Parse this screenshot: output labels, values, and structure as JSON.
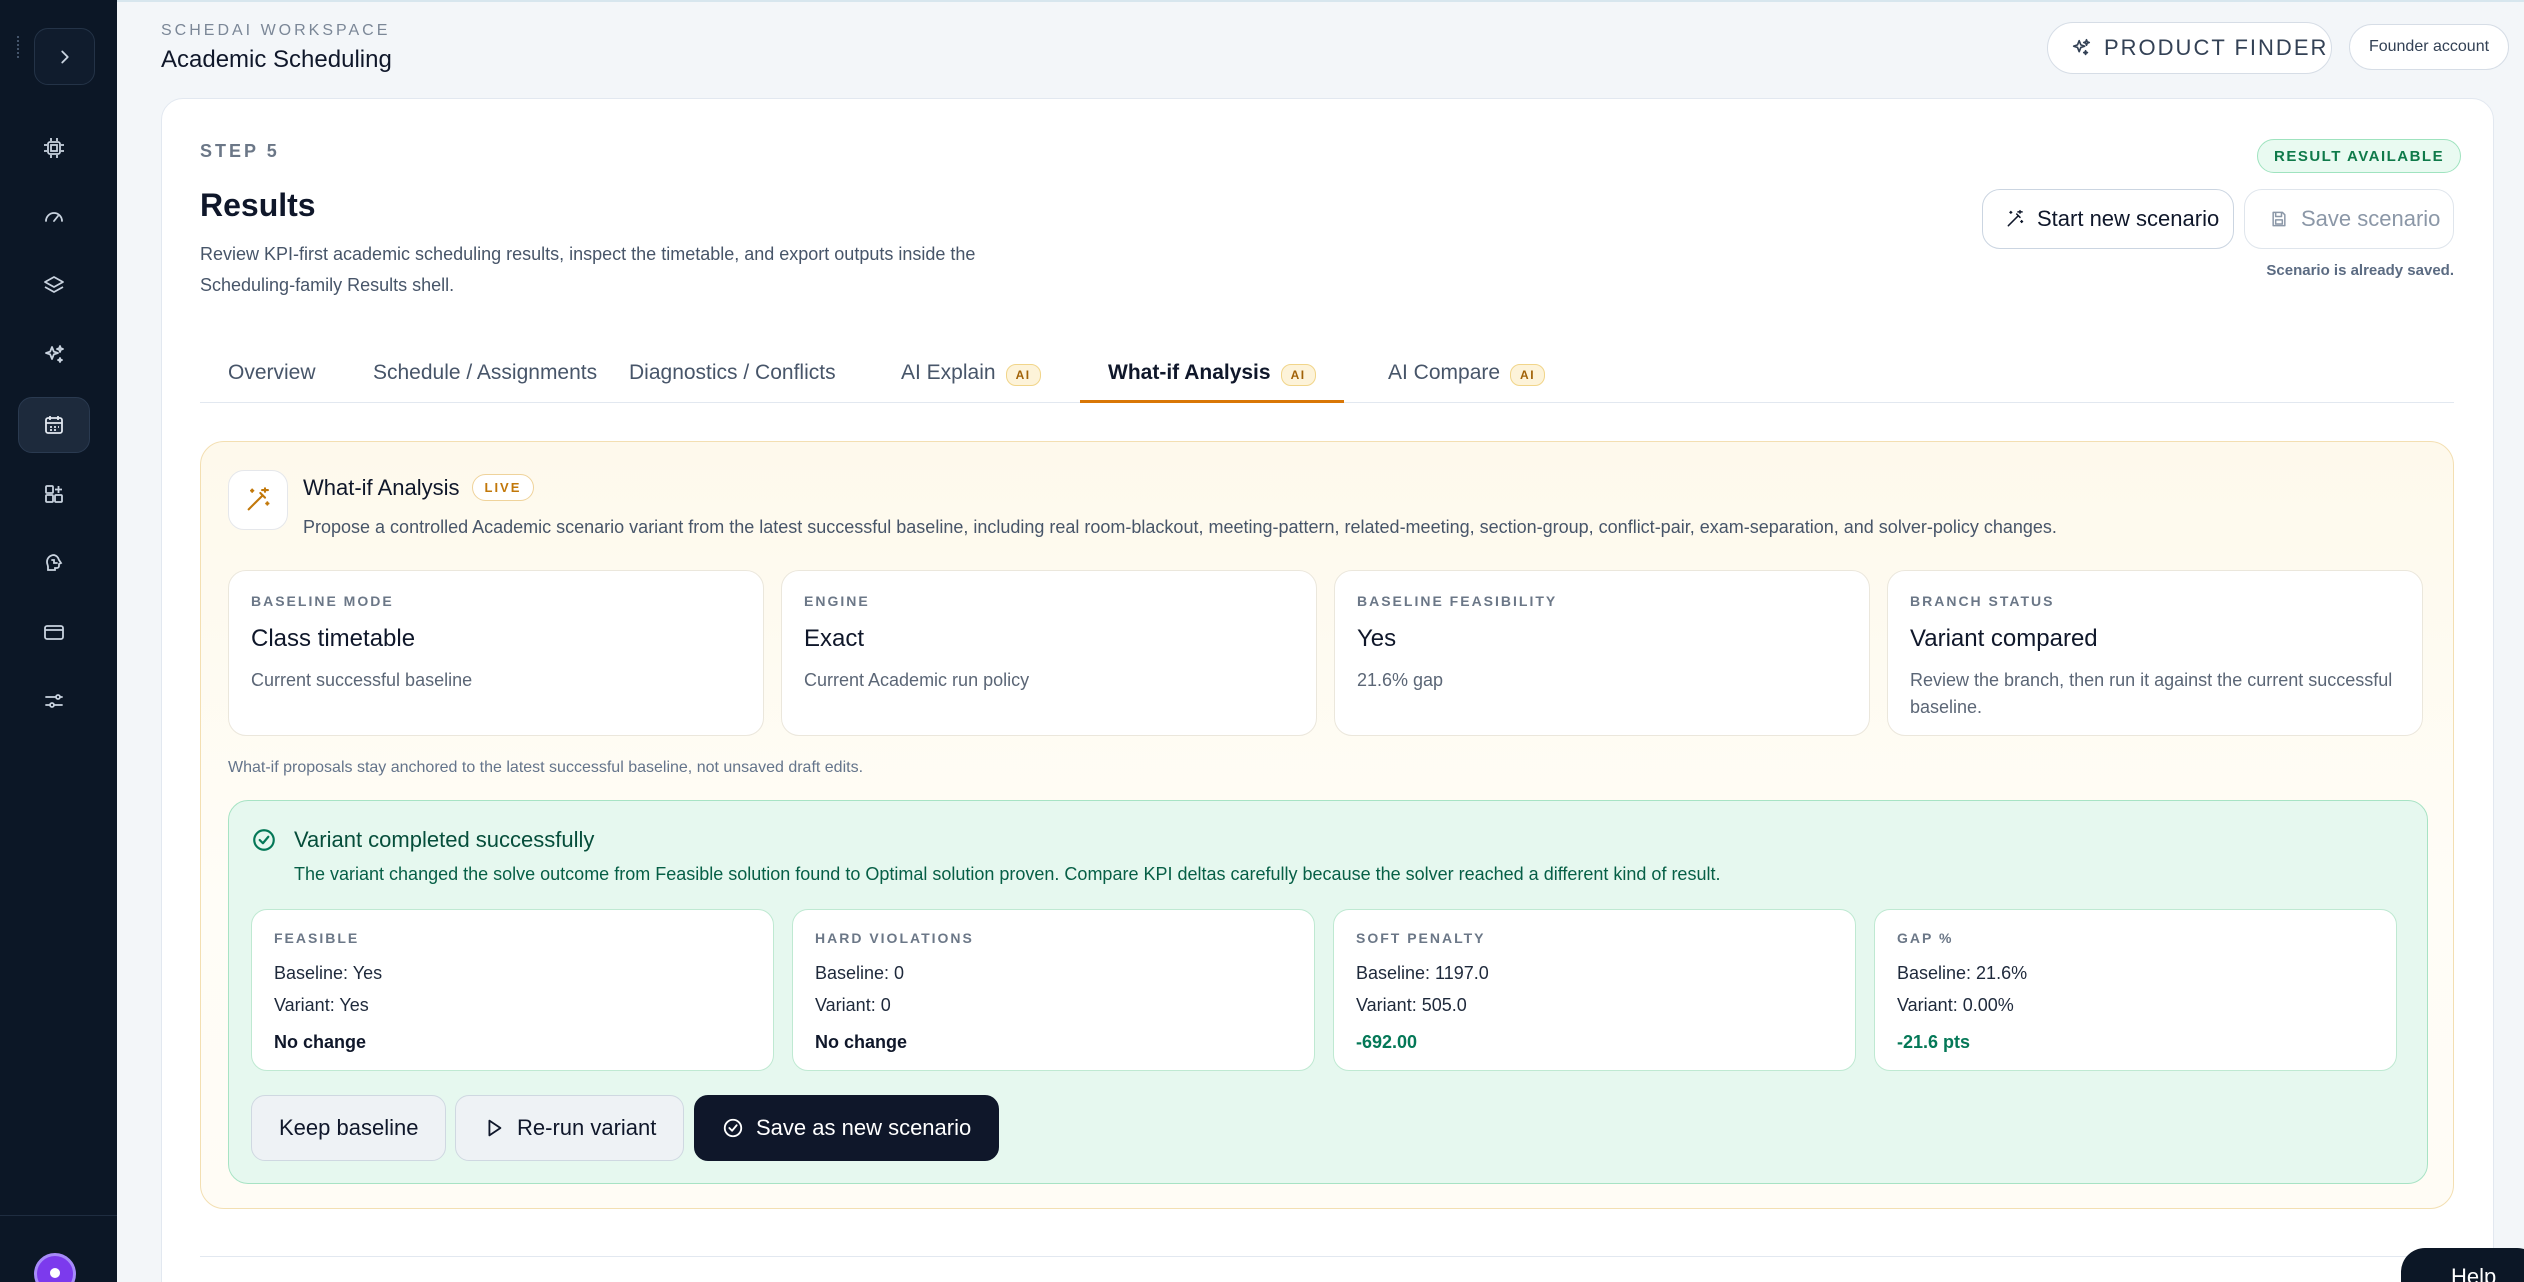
{
  "workspace": {
    "label": "SCHEDAI WORKSPACE",
    "title": "Academic Scheduling"
  },
  "header": {
    "product_finder": "PRODUCT FINDER",
    "account": "Founder account"
  },
  "sidebar": {
    "items": [
      {
        "icon": "cpu-icon"
      },
      {
        "icon": "gauge-icon"
      },
      {
        "icon": "layers-icon"
      },
      {
        "icon": "sparkles-icon"
      },
      {
        "icon": "calendar-icon",
        "active": true
      },
      {
        "icon": "grid-plus-icon"
      },
      {
        "icon": "brain-icon"
      },
      {
        "icon": "credit-card-icon"
      },
      {
        "icon": "sliders-icon"
      }
    ]
  },
  "results": {
    "step": "STEP 5",
    "title": "Results",
    "description": "Review KPI-first academic scheduling results, inspect the timetable, and export outputs inside the Scheduling-family Results shell.",
    "badge": "RESULT AVAILABLE",
    "start_new": "Start new scenario",
    "save_scenario": "Save scenario",
    "saved_note": "Scenario is already saved."
  },
  "tabs": [
    {
      "label": "Overview",
      "ai": false
    },
    {
      "label": "Schedule / Assignments",
      "ai": false
    },
    {
      "label": "Diagnostics / Conflicts",
      "ai": false
    },
    {
      "label": "AI Explain",
      "ai": true,
      "ai_label": "AI"
    },
    {
      "label": "What-if Analysis",
      "ai": true,
      "ai_label": "AI",
      "active": true
    },
    {
      "label": "AI Compare",
      "ai": true,
      "ai_label": "AI"
    }
  ],
  "whatif": {
    "title": "What-if Analysis",
    "live": "LIVE",
    "description": "Propose a controlled Academic scenario variant from the latest successful baseline, including real room-blackout, meeting-pattern, related-meeting, section-group, conflict-pair, exam-separation, and solver-policy changes.",
    "stats": [
      {
        "label": "BASELINE MODE",
        "value": "Class timetable",
        "sub": "Current successful baseline"
      },
      {
        "label": "ENGINE",
        "value": "Exact",
        "sub": "Current Academic run policy"
      },
      {
        "label": "BASELINE FEASIBILITY",
        "value": "Yes",
        "sub": "21.6% gap"
      },
      {
        "label": "BRANCH STATUS",
        "value": "Variant compared",
        "sub": "Review the branch, then run it against the current successful baseline."
      }
    ],
    "anchor_note": "What-if proposals stay anchored to the latest successful baseline, not unsaved draft edits."
  },
  "variant": {
    "title": "Variant completed successfully",
    "description": "The variant changed the solve outcome from Feasible solution found to Optimal solution proven. Compare KPI deltas carefully because the solver reached a different kind of result.",
    "kpis": [
      {
        "label": "FEASIBLE",
        "baseline": "Baseline: Yes",
        "variant": "Variant: Yes",
        "delta": "No change",
        "good": false
      },
      {
        "label": "HARD VIOLATIONS",
        "baseline": "Baseline: 0",
        "variant": "Variant: 0",
        "delta": "No change",
        "good": false
      },
      {
        "label": "SOFT PENALTY",
        "baseline": "Baseline: 1197.0",
        "variant": "Variant: 505.0",
        "delta": "-692.00",
        "good": true
      },
      {
        "label": "GAP %",
        "baseline": "Baseline: 21.6%",
        "variant": "Variant: 0.00%",
        "delta": "-21.6 pts",
        "good": true
      }
    ],
    "actions": {
      "keep": "Keep baseline",
      "rerun": "Re-run variant",
      "save_new": "Save as new scenario"
    }
  },
  "help": {
    "label": "Help"
  },
  "colors": {
    "sidebar_bg": "#0c1726",
    "accent_tab": "#d97706",
    "success": "#047857",
    "primary_btn": "#0f172a"
  }
}
